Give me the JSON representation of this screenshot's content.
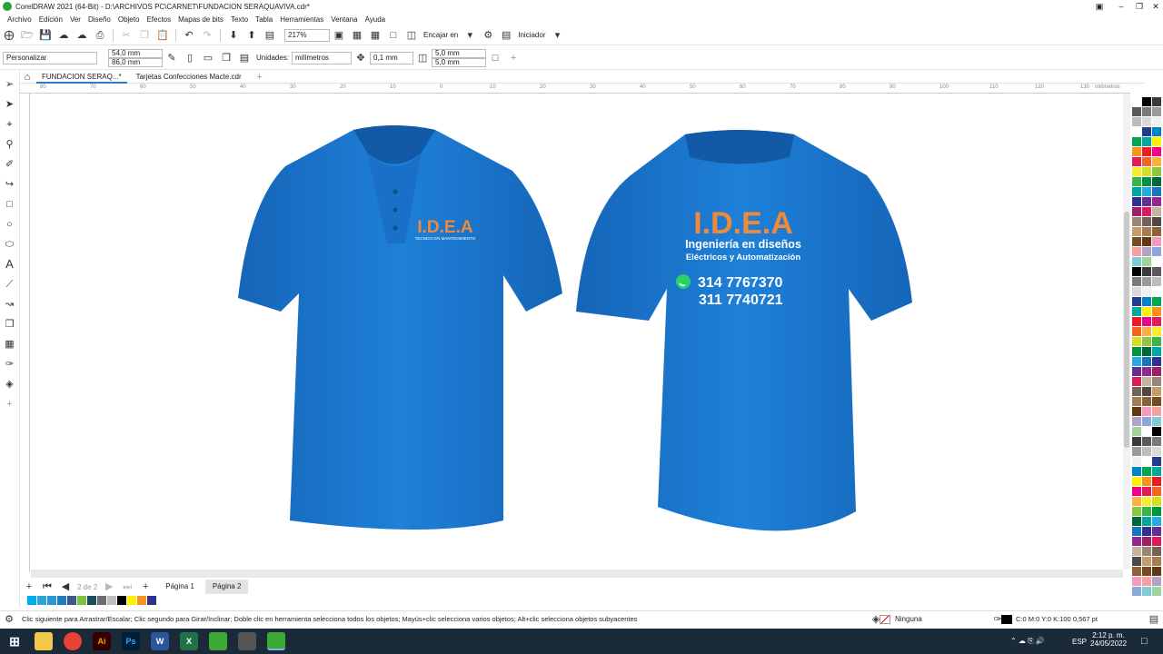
{
  "window": {
    "title": "CorelDRAW 2021 (64-Bit) - D:\\ARCHIVOS PC\\CARNET\\FUNDACION SERAQUAVIVA.cdr*"
  },
  "menu": [
    "Archivo",
    "Edición",
    "Ver",
    "Diseño",
    "Objeto",
    "Efectos",
    "Mapas de bits",
    "Texto",
    "Tabla",
    "Herramientas",
    "Ventana",
    "Ayuda"
  ],
  "toolbar1": {
    "zoom": "217%",
    "snap_label": "Encajar en",
    "launcher": "Iniciador"
  },
  "toolbar2": {
    "preset": "Personalizar",
    "width": "54,0 mm",
    "height": "86,0 mm",
    "units_label": "Unidades:",
    "units_value": "milímetros",
    "nudge": "0,1 mm",
    "dup_x": "5,0 mm",
    "dup_y": "5,0 mm"
  },
  "tabs": [
    "FUNDACION SERAQ...*",
    "Tarjetas Confecciones Macte.cdr"
  ],
  "ruler": {
    "unit": "milímetros",
    "ticks": [
      "80",
      "70",
      "60",
      "50",
      "40",
      "30",
      "20",
      "10",
      "0",
      "10",
      "20",
      "30",
      "40",
      "50",
      "60",
      "70",
      "80",
      "90",
      "100",
      "110",
      "120",
      "130"
    ]
  },
  "design": {
    "front_logo": "I.D.E.A",
    "front_sub": "TECNICO EN MANTENIMIENTO",
    "back_logo": "I.D.E.A",
    "back_line1": "Ingeniería en diseños",
    "back_line2": "Eléctricos y Automatización",
    "phone1": "314 7767370",
    "phone2": "311 7740721",
    "shirt_color": "#1a7ad4",
    "text_color": "#ef8a3a"
  },
  "pages": {
    "counter": "2 de 2",
    "tab1": "Página 1",
    "tab2": "Página 2"
  },
  "status": {
    "hint": "Clic siguiente para Arrastrar/Escalar; Clic segundo para Girar/Inclinar; Doble clic en herramienta selecciona todos los objetos; Mayús+clic selecciona varios objetos; Alt+clic selecciona objetos subyacentes",
    "fill": "Ninguna",
    "outline": "C:0 M:0 Y:0 K:100  0,567 pt"
  },
  "taskbar": {
    "lang": "ESP",
    "time": "2:12 p. m.",
    "date": "24/05/2022"
  },
  "palette_colors": [
    "#ffffff",
    "#000000",
    "#3a3a3a",
    "#5a5a5a",
    "#7a7a7a",
    "#9a9a9a",
    "#bdbdbd",
    "#d9d9d9",
    "#f0f0f0",
    "#ffffff",
    "#1f3c8f",
    "#0083c9",
    "#00a651",
    "#00a99d",
    "#fff200",
    "#f7941d",
    "#ed1c24",
    "#ec008c",
    "#e31b5a",
    "#f26522",
    "#fbb040",
    "#f9ed32",
    "#d7df23",
    "#8dc63f",
    "#39b54a",
    "#009444",
    "#006838",
    "#00a79d",
    "#27aae1",
    "#1c75bc",
    "#2e3192",
    "#662d91",
    "#92278f",
    "#9e1f63",
    "#da1c5c",
    "#c2b59b",
    "#998675",
    "#736357",
    "#534741",
    "#c69c6d",
    "#a67c52",
    "#8c6239",
    "#754c24",
    "#603913",
    "#f49ac1",
    "#f6a0a0",
    "#b3a2c7",
    "#8ba8d9",
    "#7fcdd3",
    "#a3d39c"
  ],
  "doc_palette": [
    "#00aeef",
    "#29a6de",
    "#2b96d0",
    "#1d7fc2",
    "#3b5a8a",
    "#78c43e",
    "#1b4e5b",
    "#6d6e71",
    "#bcbec0",
    "#000000",
    "#fff200",
    "#f7941d",
    "#2e3192"
  ]
}
